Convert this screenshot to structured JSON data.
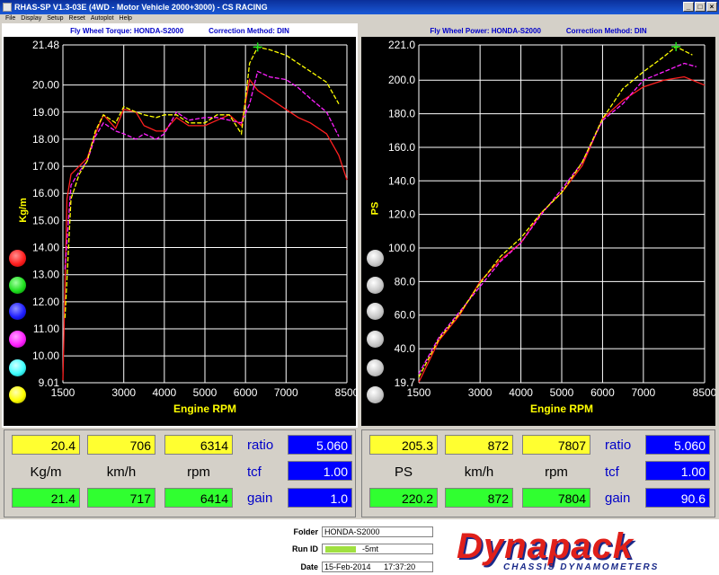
{
  "window": {
    "title": "RHAS-SP V1.3-03E  (4WD - Motor Vehicle 2000+3000) - CS RACING"
  },
  "menu": [
    "File",
    "Display",
    "Setup",
    "Reset",
    "Autoplot",
    "Help"
  ],
  "left": {
    "title": "Fly Wheel Torque: HONDA-S2000",
    "method": "Correction Method: DIN",
    "ylabel": "Kg/m",
    "xlabel": "Engine RPM",
    "yticks": [
      "21.48",
      "20.00",
      "19.00",
      "18.00",
      "17.00",
      "16.00",
      "15.00",
      "14.00",
      "13.00",
      "12.00",
      "11.00",
      "10.00",
      "9.01"
    ],
    "xticks": [
      "1500",
      "3000",
      "4000",
      "5000",
      "6000",
      "7000",
      "8500"
    ]
  },
  "right": {
    "title": "Fly Wheel Power: HONDA-S2000",
    "method": "Correction Method: DIN",
    "ylabel": "PS",
    "xlabel": "Engine RPM",
    "yticks": [
      "221.0",
      "200.0",
      "180.0",
      "160.0",
      "140.0",
      "120.0",
      "100.0",
      "80.0",
      "60.0",
      "40.0",
      "19.7"
    ],
    "xticks": [
      "1500",
      "3000",
      "4000",
      "5000",
      "6000",
      "7000",
      "8500"
    ]
  },
  "colors": {
    "red": "#ff2020",
    "green": "#20e020",
    "blue": "#2020ff",
    "magenta": "#ff20ff",
    "cyan": "#40ffff",
    "yellow": "#ffff00"
  },
  "readouts": {
    "left": {
      "top": [
        "20.4",
        "706",
        "6314"
      ],
      "units": [
        "Kg/m",
        "km/h",
        "rpm"
      ],
      "bottom": [
        "21.4",
        "717",
        "6414"
      ],
      "labels": [
        "ratio",
        "tcf",
        "gain"
      ],
      "values": [
        "5.060",
        "1.00",
        "1.0"
      ]
    },
    "right": {
      "top": [
        "205.3",
        "872",
        "7807"
      ],
      "units": [
        "PS",
        "km/h",
        "rpm"
      ],
      "bottom": [
        "220.2",
        "872",
        "7804"
      ],
      "labels": [
        "ratio",
        "tcf",
        "gain"
      ],
      "values": [
        "5.060",
        "1.00",
        "90.6"
      ]
    }
  },
  "footer": {
    "folder_label": "Folder",
    "folder": "HONDA-S2000",
    "runid_label": "Run ID",
    "runid": "-5mt",
    "date_label": "Date",
    "date": "15-Feb-2014",
    "time": "17:37:20"
  },
  "logo": {
    "main": "Dynapack",
    "sub": "CHASSIS DYNAMOMETERS"
  },
  "chart_data": [
    {
      "type": "line",
      "title": "Fly Wheel Torque: HONDA-S2000",
      "ylabel": "Kg/m",
      "xlabel": "Engine RPM",
      "xlim": [
        1500,
        8500
      ],
      "ylim": [
        9.01,
        21.48
      ],
      "series": [
        {
          "color": "#ff2020",
          "x": [
            1500,
            1600,
            1700,
            1900,
            2100,
            2300,
            2500,
            2800,
            3000,
            3300,
            3500,
            3800,
            4000,
            4300,
            4600,
            5000,
            5300,
            5600,
            5900,
            6100,
            6300,
            6600,
            7000,
            7300,
            7600,
            8000,
            8300,
            8500
          ],
          "y": [
            9.1,
            15.8,
            16.7,
            17.0,
            17.3,
            18.2,
            18.9,
            18.4,
            19.1,
            19.0,
            18.5,
            18.3,
            18.3,
            18.8,
            18.5,
            18.5,
            18.7,
            18.9,
            18.5,
            20.2,
            19.8,
            19.5,
            19.1,
            18.8,
            18.6,
            18.2,
            17.4,
            16.5
          ]
        },
        {
          "color": "#ff20ff",
          "x": [
            1550,
            1700,
            1900,
            2100,
            2300,
            2500,
            2800,
            3000,
            3300,
            3500,
            3800,
            4000,
            4300,
            4600,
            5000,
            5300,
            5600,
            5900,
            6100,
            6300,
            6600,
            7000,
            7300,
            7600,
            8000,
            8300
          ],
          "y": [
            13.2,
            16.3,
            16.8,
            17.2,
            18.1,
            18.6,
            18.3,
            18.2,
            18.0,
            18.2,
            18.0,
            18.2,
            19.0,
            18.7,
            18.8,
            18.8,
            18.7,
            18.6,
            19.3,
            20.5,
            20.3,
            20.2,
            19.9,
            19.5,
            19.0,
            18.1
          ]
        },
        {
          "color": "#ffff00",
          "x": [
            1550,
            1700,
            1900,
            2100,
            2300,
            2500,
            2800,
            3000,
            3300,
            3500,
            3800,
            4000,
            4300,
            4600,
            5000,
            5300,
            5600,
            5900,
            6100,
            6300,
            6600,
            7000,
            7300,
            7600,
            8000,
            8300
          ],
          "y": [
            11.4,
            15.8,
            16.7,
            17.2,
            18.3,
            18.9,
            18.6,
            19.2,
            19.0,
            18.9,
            18.8,
            18.9,
            18.9,
            18.6,
            18.6,
            18.9,
            18.9,
            18.2,
            20.8,
            21.4,
            21.3,
            21.1,
            20.8,
            20.5,
            20.1,
            19.3
          ]
        }
      ]
    },
    {
      "type": "line",
      "title": "Fly Wheel Power: HONDA-S2000",
      "ylabel": "PS",
      "xlabel": "Engine RPM",
      "xlim": [
        1500,
        8500
      ],
      "ylim": [
        19.7,
        221.0
      ],
      "series": [
        {
          "color": "#ff2020",
          "x": [
            1500,
            2000,
            2500,
            3000,
            3500,
            4000,
            4500,
            5000,
            5500,
            6000,
            6500,
            7000,
            7500,
            8000,
            8500
          ],
          "y": [
            20,
            45,
            60,
            80,
            93,
            103,
            121,
            133,
            149,
            177,
            188,
            196,
            200,
            202,
            197
          ]
        },
        {
          "color": "#ff20ff",
          "x": [
            1500,
            2000,
            2500,
            3000,
            3500,
            4000,
            4500,
            5000,
            5500,
            6000,
            6500,
            7000,
            7500,
            8000,
            8300
          ],
          "y": [
            25,
            47,
            62,
            77,
            92,
            103,
            120,
            135,
            151,
            176,
            186,
            200,
            205,
            210,
            208
          ]
        },
        {
          "color": "#ffff00",
          "x": [
            1500,
            2000,
            2500,
            3000,
            3500,
            4000,
            4500,
            5000,
            5500,
            6000,
            6500,
            7000,
            7500,
            7800,
            8200
          ],
          "y": [
            23,
            46,
            61,
            79,
            95,
            106,
            121,
            133,
            151,
            177,
            195,
            205,
            214,
            220,
            215
          ]
        }
      ]
    }
  ]
}
